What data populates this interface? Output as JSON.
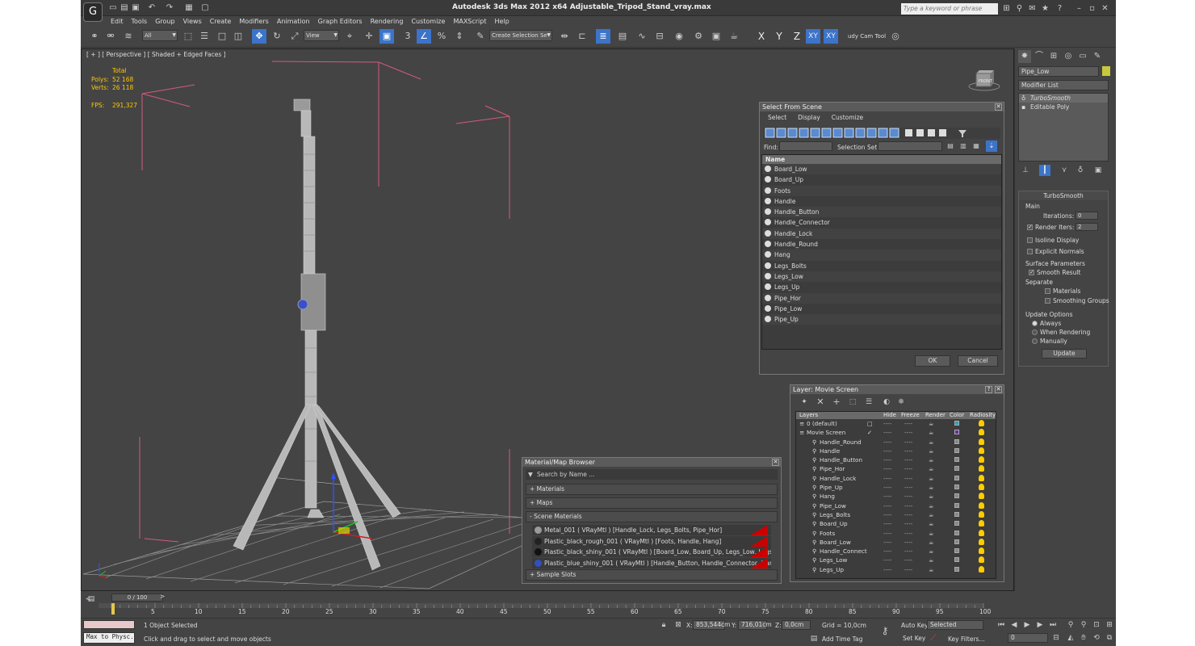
{
  "app": {
    "title": "Autodesk 3ds Max  2012 x64     Adjustable_Tripod_Stand_vray.max",
    "logo": "G",
    "search_placeholder": "Type a keyword or phrase"
  },
  "menu": [
    "Edit",
    "Tools",
    "Group",
    "Views",
    "Create",
    "Modifiers",
    "Animation",
    "Graph Editors",
    "Rendering",
    "Customize",
    "MAXScript",
    "Help"
  ],
  "toolbar": {
    "filter": "All",
    "ref_coord": "View",
    "selection_set": "Create Selection Se",
    "snap_label": "3",
    "axes": [
      "X",
      "Y",
      "Z",
      "XY",
      "XY"
    ],
    "studio": "udy Cam Tool"
  },
  "viewport": {
    "label": "[ + ] [ Perspective ] [ Shaded + Edged Faces ]",
    "stats": {
      "total": "Total",
      "polys_label": "Polys:",
      "polys": "52 168",
      "verts_label": "Verts:",
      "verts": "26 118",
      "fps_label": "FPS:",
      "fps": "291,327"
    },
    "cube_label": "FRONT"
  },
  "select_dialog": {
    "title": "Select From Scene",
    "menu": [
      "Select",
      "Display",
      "Customize"
    ],
    "find_label": "Find:",
    "selset_label": "Selection Set:",
    "column": "Name",
    "items": [
      "Board_Low",
      "Board_Up",
      "Foots",
      "Handle",
      "Handle_Button",
      "Handle_Connector",
      "Handle_Lock",
      "Handle_Round",
      "Hang",
      "Legs_Bolts",
      "Legs_Low",
      "Legs_Up",
      "Pipe_Hor",
      "Pipe_Low",
      "Pipe_Up"
    ],
    "ok": "OK",
    "cancel": "Cancel"
  },
  "layer_dialog": {
    "title": "Layer: Movie Screen",
    "columns": {
      "layers": "Layers",
      "hide": "Hide",
      "freeze": "Freeze",
      "render": "Render",
      "color": "Color",
      "radiosity": "Radiosity"
    },
    "rows": [
      {
        "name": "0 (default)",
        "level": 0,
        "color": "#29a3b8",
        "check": "□"
      },
      {
        "name": "Movie Screen",
        "level": 0,
        "color": "#6a2aa8",
        "check": "✓"
      },
      {
        "name": "Handle_Round",
        "level": 1,
        "color": "#888888",
        "check": ""
      },
      {
        "name": "Handle",
        "level": 1,
        "color": "#888888",
        "check": ""
      },
      {
        "name": "Handle_Button",
        "level": 1,
        "color": "#888888",
        "check": ""
      },
      {
        "name": "Pipe_Hor",
        "level": 1,
        "color": "#888888",
        "check": ""
      },
      {
        "name": "Handle_Lock",
        "level": 1,
        "color": "#888888",
        "check": ""
      },
      {
        "name": "Pipe_Up",
        "level": 1,
        "color": "#888888",
        "check": ""
      },
      {
        "name": "Hang",
        "level": 1,
        "color": "#888888",
        "check": ""
      },
      {
        "name": "Pipe_Low",
        "level": 1,
        "color": "#888888",
        "check": ""
      },
      {
        "name": "Legs_Bolts",
        "level": 1,
        "color": "#888888",
        "check": ""
      },
      {
        "name": "Board_Up",
        "level": 1,
        "color": "#888888",
        "check": ""
      },
      {
        "name": "Foots",
        "level": 1,
        "color": "#888888",
        "check": ""
      },
      {
        "name": "Board_Low",
        "level": 1,
        "color": "#888888",
        "check": ""
      },
      {
        "name": "Handle_Connect",
        "level": 1,
        "color": "#888888",
        "check": ""
      },
      {
        "name": "Legs_Low",
        "level": 1,
        "color": "#888888",
        "check": ""
      },
      {
        "name": "Legs_Up",
        "level": 1,
        "color": "#888888",
        "check": ""
      }
    ],
    "dash": "----"
  },
  "material_browser": {
    "title": "Material/Map Browser",
    "search": "Search by Name ...",
    "sections": {
      "materials": "+ Materials",
      "maps": "+ Maps",
      "scene": "- Scene Materials",
      "sample": "+ Sample Slots"
    },
    "materials": [
      {
        "label": "Metal_001  ( VRayMtl )  [Handle_Lock, Legs_Bolts, Pipe_Hor]",
        "color": "#9a9a9a"
      },
      {
        "label": "Plastic_black_rough_001  ( VRayMtl ) [Foots, Handle, Hang]",
        "color": "#222222"
      },
      {
        "label": "Plastic_black_shiny_001  ( VRayMtl ) [Board_Low, Board_Up, Legs_Low, Legs_U...",
        "color": "#111111"
      },
      {
        "label": "Plastic_blue_shiny_001  ( VRayMtl ) [Handle_Button, Handle_Connector, Handle...",
        "color": "#3050c0"
      }
    ]
  },
  "command_panel": {
    "object_name": "Pipe_Low",
    "modifier_list": "Modifier List",
    "stack": [
      "TurboSmooth",
      "Editable Poly"
    ],
    "turbosmooth": {
      "title": "TurboSmooth",
      "main": "Main",
      "iterations_label": "Iterations:",
      "iterations": "0",
      "render_iters_label": "Render Iters:",
      "render_iters": "2",
      "isoline": "Isoline Display",
      "explicit": "Explicit Normals",
      "surface": "Surface Parameters",
      "smooth_result": "Smooth Result",
      "separate": "Separate",
      "materials": "Materials",
      "smoothing_groups": "Smoothing Groups",
      "update_options": "Update Options",
      "always": "Always",
      "when_rendering": "When Rendering",
      "manually": "Manually",
      "update": "Update"
    },
    "accent_color": "#c8c83c"
  },
  "timeline": {
    "frame": "0 / 100",
    "ticks": [
      "0",
      "5",
      "10",
      "15",
      "20",
      "25",
      "30",
      "35",
      "40",
      "45",
      "50",
      "55",
      "60",
      "65",
      "70",
      "75",
      "80",
      "85",
      "90",
      "95",
      "100"
    ]
  },
  "status": {
    "maxscript": "Max to Physc.",
    "selected": "1 Object Selected",
    "prompt": "Click and drag to select and move objects",
    "x_label": "X:",
    "x": "853,544cm",
    "y_label": "Y:",
    "y": "716,01cm",
    "z_label": "Z:",
    "z": "0,0cm",
    "grid": "Grid = 10,0cm",
    "add_time_tag": "Add Time Tag",
    "auto_key": "Auto Key",
    "set_key": "Set Key",
    "key_mode": "Selected",
    "key_filters": "Key Filters...",
    "frame_field": "0"
  }
}
